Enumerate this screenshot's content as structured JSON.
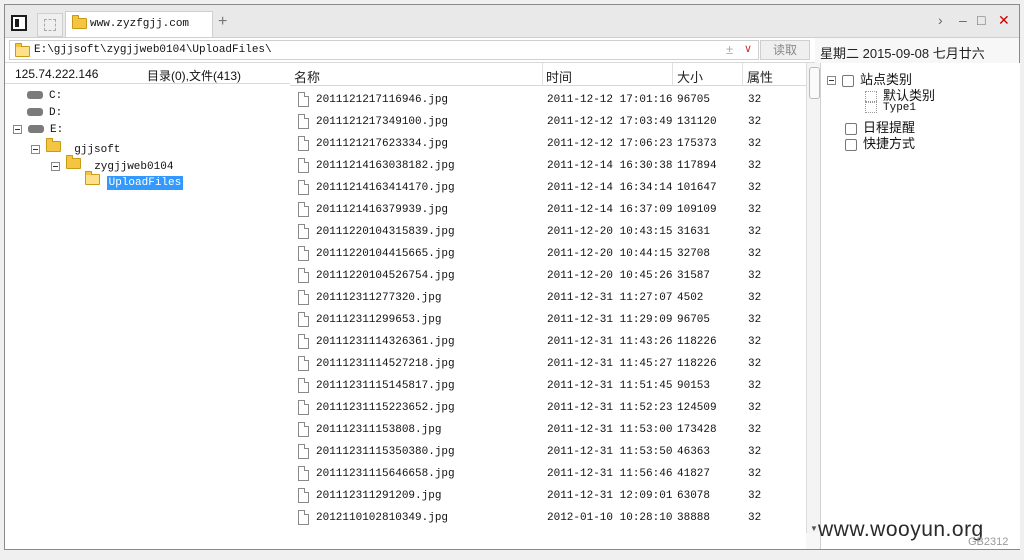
{
  "tab": {
    "title": "www.zyzfgjj.com"
  },
  "address": {
    "path": "E:\\gjjsoft\\zygjjweb0104\\UploadFiles\\",
    "read_label": "读取"
  },
  "date_header": "星期二 2015-09-08 七月廿六",
  "left": {
    "ip": "125.74.222.146",
    "dir_summary": "目录(0),文件(413)",
    "tree": [
      "C:",
      "D:",
      "E:",
      "gjjsoft",
      "zygjjweb0104",
      "UploadFiles"
    ]
  },
  "columns": {
    "name": "名称",
    "time": "时间",
    "size": "大小",
    "attr": "属性"
  },
  "files": [
    {
      "name": "2011121217116946.jpg",
      "time": "2011-12-12 17:01:16",
      "size": "96705",
      "attr": "32"
    },
    {
      "name": "2011121217349100.jpg",
      "time": "2011-12-12 17:03:49",
      "size": "131120",
      "attr": "32"
    },
    {
      "name": "2011121217623334.jpg",
      "time": "2011-12-12 17:06:23",
      "size": "175373",
      "attr": "32"
    },
    {
      "name": "20111214163038182.jpg",
      "time": "2011-12-14 16:30:38",
      "size": "117894",
      "attr": "32"
    },
    {
      "name": "20111214163414170.jpg",
      "time": "2011-12-14 16:34:14",
      "size": "101647",
      "attr": "32"
    },
    {
      "name": "2011121416379939.jpg",
      "time": "2011-12-14 16:37:09",
      "size": "109109",
      "attr": "32"
    },
    {
      "name": "20111220104315839.jpg",
      "time": "2011-12-20 10:43:15",
      "size": "31631",
      "attr": "32"
    },
    {
      "name": "20111220104415665.jpg",
      "time": "2011-12-20 10:44:15",
      "size": "32708",
      "attr": "32"
    },
    {
      "name": "20111220104526754.jpg",
      "time": "2011-12-20 10:45:26",
      "size": "31587",
      "attr": "32"
    },
    {
      "name": "201112311277320.jpg",
      "time": "2011-12-31 11:27:07",
      "size": "4502",
      "attr": "32"
    },
    {
      "name": "201112311299653.jpg",
      "time": "2011-12-31 11:29:09",
      "size": "96705",
      "attr": "32"
    },
    {
      "name": "20111231114326361.jpg",
      "time": "2011-12-31 11:43:26",
      "size": "118226",
      "attr": "32"
    },
    {
      "name": "20111231114527218.jpg",
      "time": "2011-12-31 11:45:27",
      "size": "118226",
      "attr": "32"
    },
    {
      "name": "20111231115145817.jpg",
      "time": "2011-12-31 11:51:45",
      "size": "90153",
      "attr": "32"
    },
    {
      "name": "20111231115223652.jpg",
      "time": "2011-12-31 11:52:23",
      "size": "124509",
      "attr": "32"
    },
    {
      "name": "201112311153808.jpg",
      "time": "2011-12-31 11:53:00",
      "size": "173428",
      "attr": "32"
    },
    {
      "name": "20111231115350380.jpg",
      "time": "2011-12-31 11:53:50",
      "size": "46363",
      "attr": "32"
    },
    {
      "name": "20111231115646658.jpg",
      "time": "2011-12-31 11:56:46",
      "size": "41827",
      "attr": "32"
    },
    {
      "name": "201112311291209.jpg",
      "time": "2011-12-31 12:09:01",
      "size": "63078",
      "attr": "32"
    },
    {
      "name": "2012110102810349.jpg",
      "time": "2012-01-10 10:28:10",
      "size": "38888",
      "attr": "32"
    }
  ],
  "right": {
    "root": "站点类别",
    "children": [
      "默认类别",
      "Type1"
    ],
    "schedule": "日程提醒",
    "shortcut": "快捷方式"
  },
  "watermark": "www.wooyun.org",
  "corner": "GB2312"
}
